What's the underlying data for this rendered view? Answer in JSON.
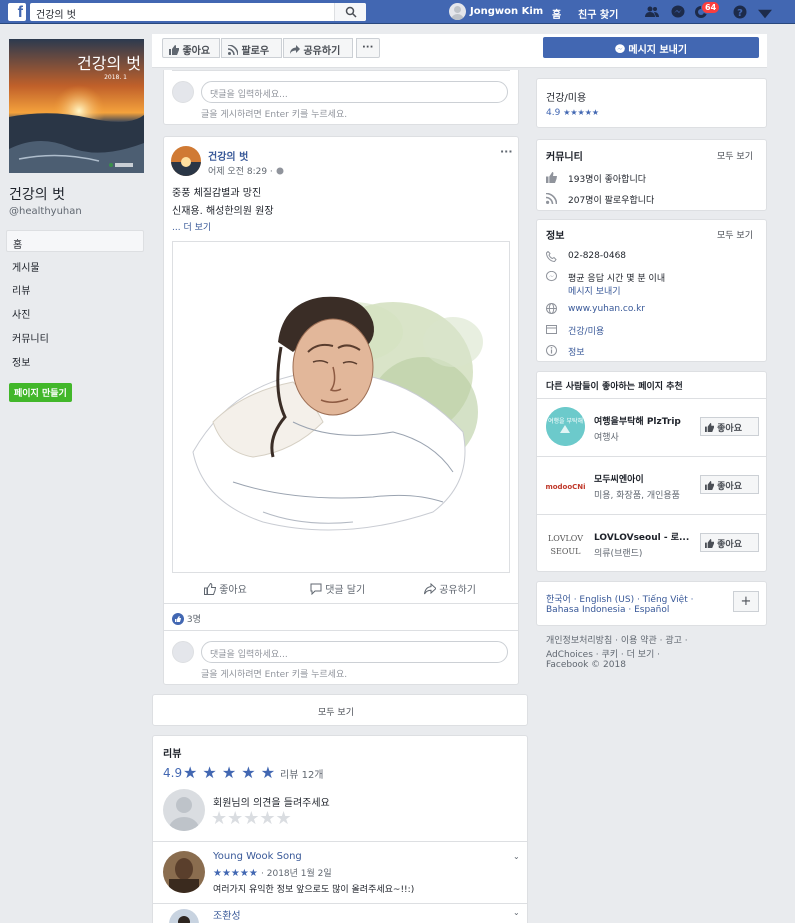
{
  "topbar": {
    "search_value": "건강의 벗",
    "user_name": "Jongwon Kim",
    "home": "홈",
    "find_friends": "친구 찾기",
    "notif_count": "64"
  },
  "page": {
    "title": "건강의 벗",
    "handle": "@healthyuhan",
    "cover_title": "건강의 벗",
    "cover_sub": "2018. 1"
  },
  "nav": {
    "items": [
      "홈",
      "게시물",
      "리뷰",
      "사진",
      "커뮤니티",
      "정보"
    ],
    "create_page": "페이지 만들기"
  },
  "actions": {
    "like": "좋아요",
    "follow": "팔로우",
    "share": "공유하기",
    "more": "···",
    "message": "메시지 보내기"
  },
  "comment_box": {
    "placeholder": "댓글을 입력하세요...",
    "hint": "글을 게시하려면 Enter 키를 누르세요."
  },
  "post": {
    "author": "건강의 벗",
    "time": "어제 오전 8:29 · ",
    "line1": "중풍 체질감별과 망진",
    "line2": "신재용. 해성한의원 원장",
    "more": "... 더 보기",
    "like": "좋아요",
    "comment": "댓글 달기",
    "share": "공유하기",
    "reactions": "3명",
    "see_all": "모두 보기"
  },
  "reviews": {
    "title": "리뷰",
    "rating": "4.9",
    "count": "리뷰 12개",
    "prompt": "회원님의 의견을 들려주세요",
    "items": [
      {
        "name": "Young Wook Song",
        "date": "· 2018년 1월 2일",
        "text": "여러가지 유익한 정보 앞으로도 많이 올려주세요~!!:)"
      },
      {
        "name": "조환성"
      }
    ]
  },
  "right": {
    "category": "건강/미용",
    "rating": "4.9",
    "community": {
      "title": "커뮤니티",
      "see_all": "모두 보기",
      "likes": "193명이 좋아합니다",
      "follows": "207명이 팔로우합니다"
    },
    "info": {
      "title": "정보",
      "see_all": "모두 보기",
      "phone": "02-828-0468",
      "response": "평균 응답 시간 몇 분 이내",
      "message": "메시지 보내기",
      "website": "www.yuhan.co.kr",
      "category": "건강/미용",
      "about": "정보"
    },
    "suggest": {
      "title": "다른 사람들이 좋아하는 페이지 추천",
      "like_label": "좋아요",
      "pages": [
        {
          "name": "여행을부탁해 PlzTrip",
          "type": "여행사",
          "logo": "여행을 부탁해"
        },
        {
          "name": "모두씨엔아이",
          "type": "미용, 화장품, 개인용품",
          "logo": "modooCNi"
        },
        {
          "name": "LOVLOVseoul - 로...",
          "type": "의류(브랜드)",
          "logo": "LOVLOV SEOUL"
        }
      ]
    },
    "languages": {
      "line1": "한국어 · English (US) · Tiếng Việt ·",
      "line2": "Bahasa Indonesia · Español",
      "plus": "+"
    },
    "footer": {
      "line1": "개인정보처리방침 · 이용 약관 · 광고 ·",
      "line2": "AdChoices  · 쿠키 · 더 보기 ·",
      "line3": "Facebook © 2018"
    }
  },
  "colors": {
    "brand": "#4267b2",
    "link": "#385898",
    "green": "#42b72a",
    "badge": "#fa3e3e"
  }
}
